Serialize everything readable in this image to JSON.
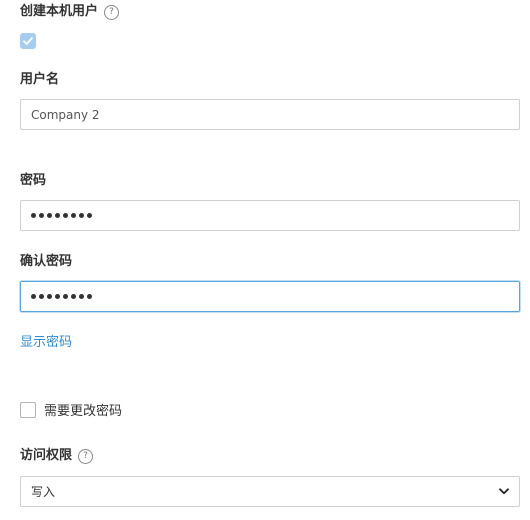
{
  "create_local_user": {
    "label": "创建本机用户",
    "help_icon": "?",
    "checked": true
  },
  "username": {
    "label": "用户名",
    "value": "Company 2"
  },
  "password": {
    "label": "密码",
    "masked_length": 8
  },
  "confirm_password": {
    "label": "确认密码",
    "masked_length": 8
  },
  "show_password_link": "显示密码",
  "require_change_password": {
    "label": "需要更改密码",
    "checked": false
  },
  "access_permission": {
    "label": "访问权限",
    "help_icon": "?",
    "selected": "写入"
  }
}
